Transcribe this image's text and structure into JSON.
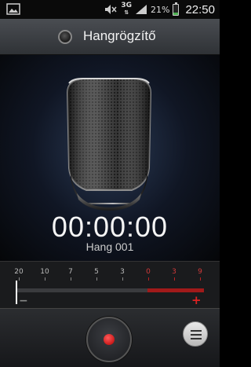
{
  "status_bar": {
    "network": "3G",
    "battery_percent": "21%",
    "battery_level": 0.21,
    "time": "22:50",
    "icons": [
      "gallery-icon",
      "notification-icon",
      "mute-icon",
      "signal-icon",
      "battery-icon"
    ]
  },
  "header": {
    "title": "Hangrögzítő"
  },
  "recording": {
    "timer": "00:00:00",
    "file_name": "Hang 001"
  },
  "level_meter": {
    "ticks": [
      {
        "label": "20",
        "warn": false
      },
      {
        "label": "10",
        "warn": false
      },
      {
        "label": "7",
        "warn": false
      },
      {
        "label": "5",
        "warn": false
      },
      {
        "label": "3",
        "warn": false
      },
      {
        "label": "0",
        "warn": true
      },
      {
        "label": "3",
        "warn": true
      },
      {
        "label": "9",
        "warn": true
      }
    ],
    "min_symbol": "−",
    "max_symbol": "+"
  },
  "colors": {
    "record_red": "#d11a1a",
    "meter_red": "#a11a1a",
    "battery_green": "#4caf50"
  }
}
